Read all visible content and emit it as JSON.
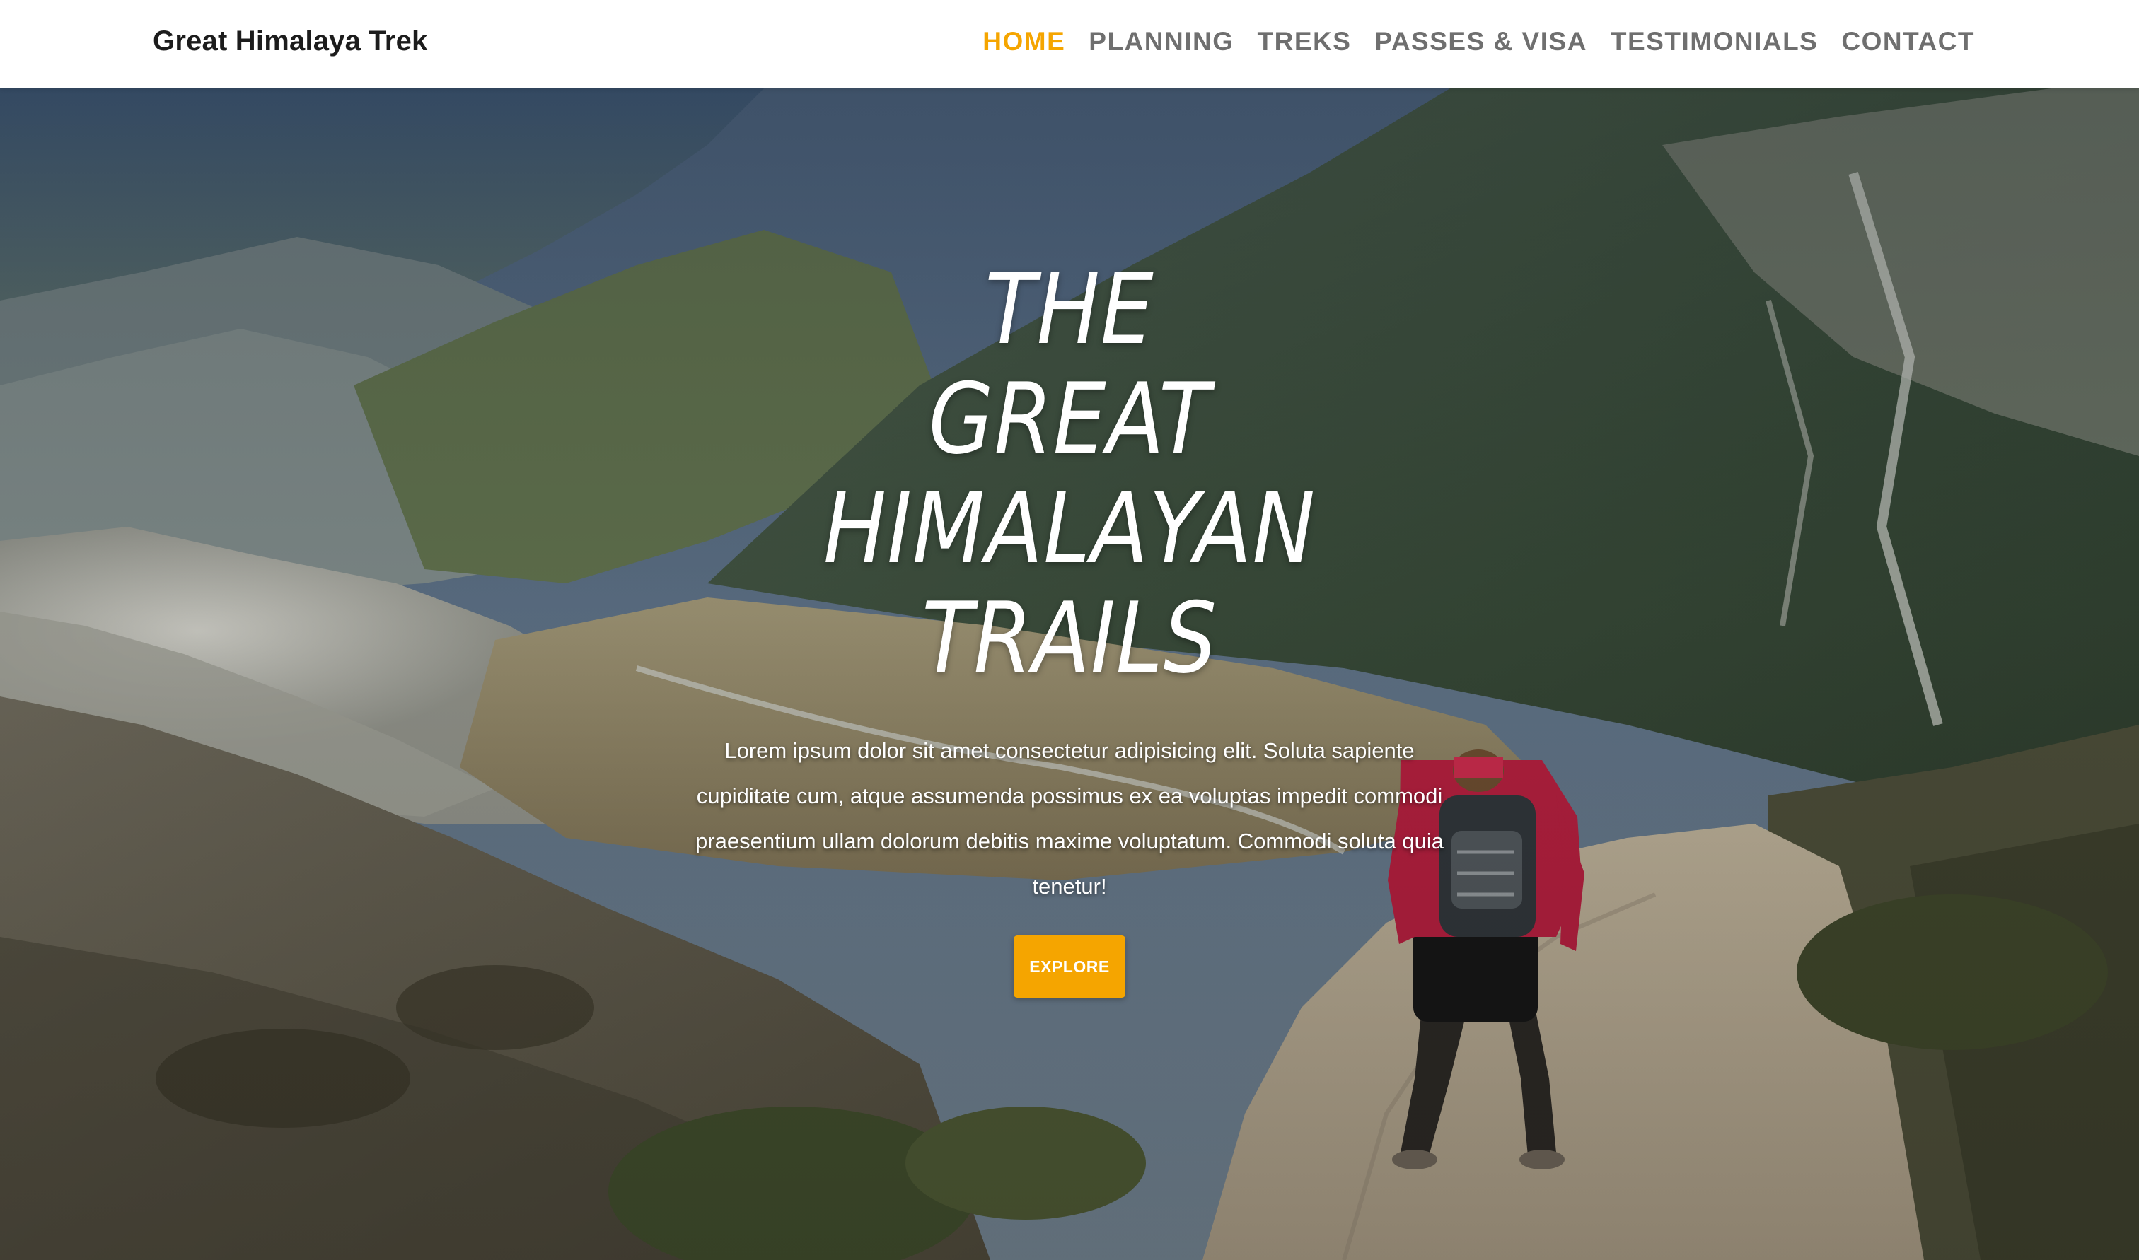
{
  "header": {
    "brand": "Great Himalaya Trek",
    "nav": [
      {
        "label": "HOME",
        "active": true
      },
      {
        "label": "PLANNING",
        "active": false
      },
      {
        "label": "TREKS",
        "active": false
      },
      {
        "label": "PASSES & VISA",
        "active": false
      },
      {
        "label": "TESTIMONIALS",
        "active": false
      },
      {
        "label": "CONTACT",
        "active": false
      }
    ]
  },
  "hero": {
    "title_lines": [
      "THE",
      "GREAT",
      "HIMALAYAN",
      "TRAILS"
    ],
    "text": "Lorem ipsum dolor sit amet consectetur adipisicing elit. Soluta sapiente cupiditate cum, atque assumenda possimus ex ea voluptas impedit commodi praesentium ullam dolorum debitis maxime voluptatum. Commodi soluta quia tenetur!",
    "button_label": "EXPLORE",
    "background": "mountain-valley-trekker-photo"
  },
  "colors": {
    "accent": "#f5a500",
    "nav_text": "#6f6f6f",
    "brand_text": "#1c1c1c",
    "navbar_bg": "#ffffff"
  }
}
